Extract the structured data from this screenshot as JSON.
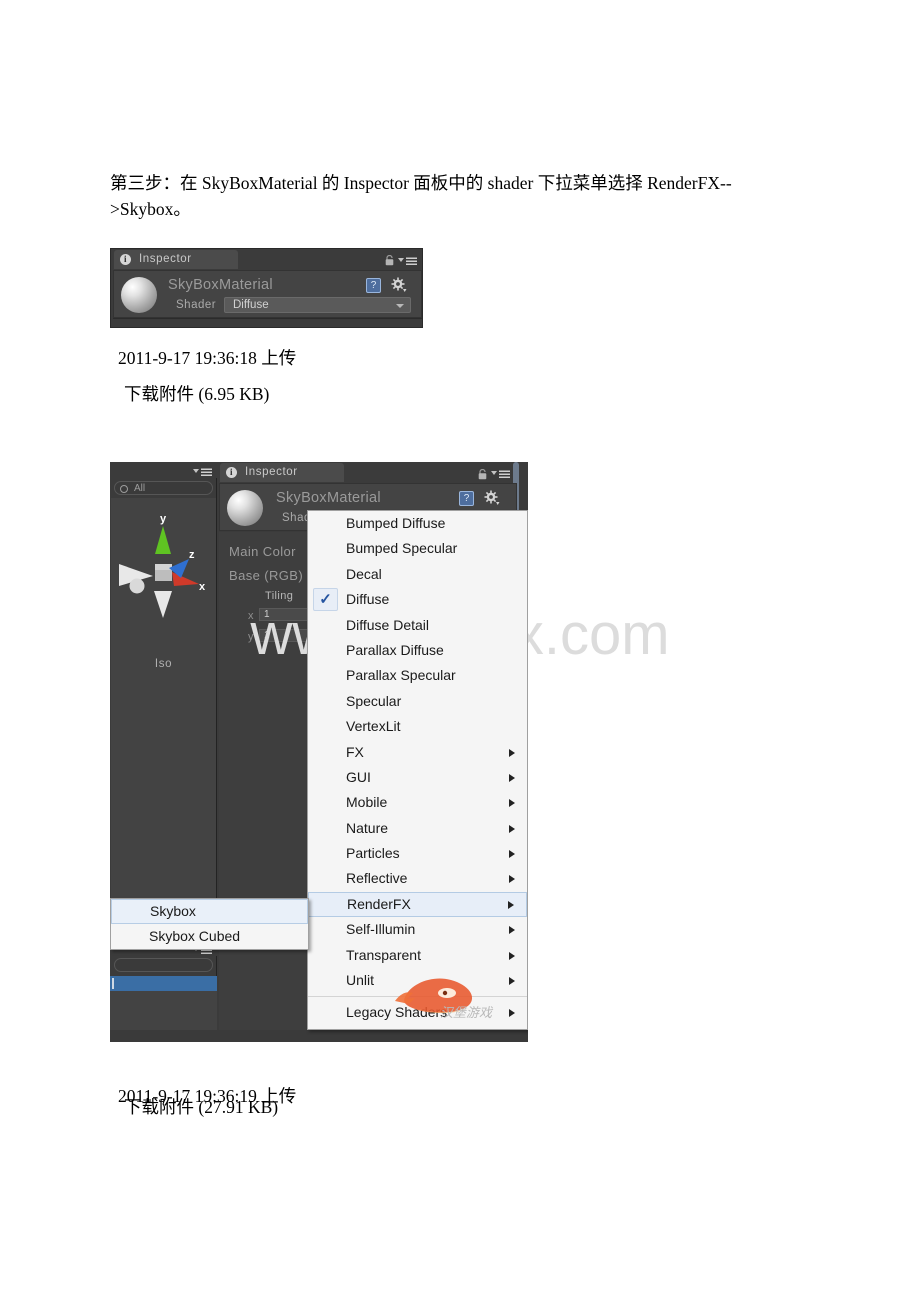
{
  "document": {
    "intro_paragraph": "第三步：在 SkyBoxMaterial 的 Inspector 面板中的 shader 下拉菜单选择 RenderFX-->Skybox。",
    "caption1_date": "2011-9-17 19:36:18 上传",
    "caption1_download": "下载附件 (6.95 KB)",
    "caption2_date": "2011-9-17 19:36:19 上传",
    "caption2_download": "下载附件 (27.91 KB)",
    "watermark": "www.bdocx.com",
    "logo_text": "汉堡游戏"
  },
  "shot1": {
    "tab_label": "Inspector",
    "tab_icon": "info-icon",
    "lock_icon": "lock-icon",
    "menu_icon": "hamburger-menu-icon",
    "material_name": "SkyBoxMaterial",
    "shader_label": "Shader",
    "shader_value": "Diffuse",
    "help_icon": "help-icon",
    "gear_icon": "gear-icon",
    "preview_icon": "material-sphere-preview"
  },
  "shot2": {
    "left_panel": {
      "search_placeholder": "All",
      "search_icon": "search-icon",
      "menu_icon": "hamburger-menu-icon",
      "scene_gizmo_label": "Iso",
      "gizmo_axes": [
        "y",
        "z",
        "x"
      ],
      "lower_menu_icon": "hamburger-menu-icon"
    },
    "inspector": {
      "tab_label": "Inspector",
      "tab_icon": "info-icon",
      "lock_icon": "lock-icon",
      "menu_icon": "hamburger-menu-icon",
      "material_name": "SkyBoxMaterial",
      "shader_label": "Shad",
      "help_icon": "help-icon",
      "gear_icon": "gear-icon",
      "properties": [
        {
          "label": "Main Color"
        },
        {
          "label": "Base (RGB)"
        }
      ],
      "tiling_label": "Tiling",
      "tiling_rows": [
        {
          "axis": "x",
          "value": "1"
        },
        {
          "axis": "y",
          "value": "1"
        }
      ]
    },
    "shader_menu": {
      "checked_item": "Diffuse",
      "highlighted_item": "RenderFX",
      "items": [
        {
          "label": "Bumped Diffuse",
          "submenu": false,
          "checked": false
        },
        {
          "label": "Bumped Specular",
          "submenu": false,
          "checked": false
        },
        {
          "label": "Decal",
          "submenu": false,
          "checked": false
        },
        {
          "label": "Diffuse",
          "submenu": false,
          "checked": true
        },
        {
          "label": "Diffuse Detail",
          "submenu": false,
          "checked": false
        },
        {
          "label": "Parallax Diffuse",
          "submenu": false,
          "checked": false
        },
        {
          "label": "Parallax Specular",
          "submenu": false,
          "checked": false
        },
        {
          "label": "Specular",
          "submenu": false,
          "checked": false
        },
        {
          "label": "VertexLit",
          "submenu": false,
          "checked": false
        },
        {
          "label": "FX",
          "submenu": true,
          "checked": false
        },
        {
          "label": "GUI",
          "submenu": true,
          "checked": false
        },
        {
          "label": "Mobile",
          "submenu": true,
          "checked": false
        },
        {
          "label": "Nature",
          "submenu": true,
          "checked": false
        },
        {
          "label": "Particles",
          "submenu": true,
          "checked": false
        },
        {
          "label": "Reflective",
          "submenu": true,
          "checked": false
        },
        {
          "label": "RenderFX",
          "submenu": true,
          "checked": false,
          "selected": true
        },
        {
          "label": "Self-Illumin",
          "submenu": true,
          "checked": false
        },
        {
          "label": "Transparent",
          "submenu": true,
          "checked": false
        },
        {
          "label": "Unlit",
          "submenu": true,
          "checked": false
        },
        {
          "label": "Legacy Shaders",
          "submenu": true,
          "checked": false,
          "after_separator": true
        }
      ]
    },
    "skybox_submenu": {
      "items": [
        {
          "label": "Skybox",
          "selected": true
        },
        {
          "label": "Skybox Cubed",
          "selected": false
        }
      ]
    }
  },
  "colors": {
    "unity_panel_bg": "#3b3b3b",
    "unity_body_bg": "#444444",
    "menu_bg": "#f5f5f5",
    "menu_highlight": "#e7eef8",
    "menu_highlight_border": "#b4cbe4",
    "selection_blue": "#3a6ea5",
    "check_blue": "#2554a0",
    "axis_x": "#d03a2a",
    "axis_y": "#5fc322",
    "axis_z": "#2f6fd0",
    "watermark_gray": "#dcdcdc"
  }
}
